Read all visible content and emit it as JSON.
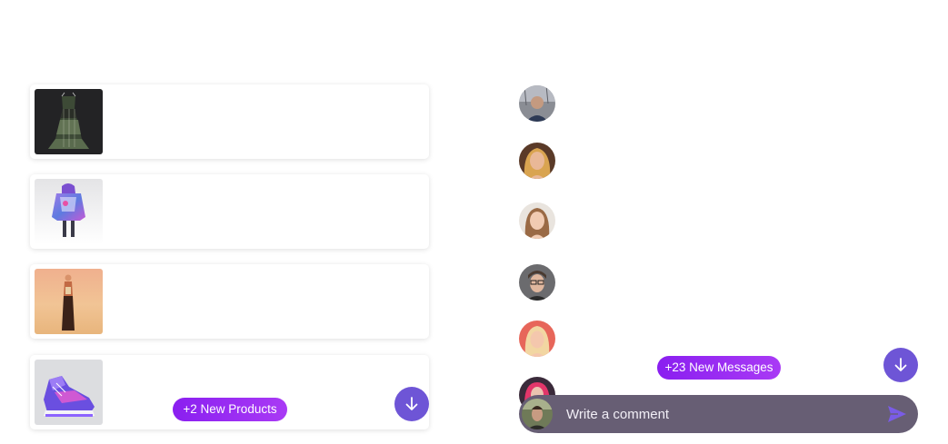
{
  "products": {
    "items": [
      {
        "name": "dark-jacquard-dress"
      },
      {
        "name": "iridescent-puffer-jacket"
      },
      {
        "name": "desert-long-coat-look"
      },
      {
        "name": "purple-high-top-sneaker"
      }
    ],
    "new_products_label": "+2 New Products",
    "scroll_down_icon": "arrow-down-icon"
  },
  "chat": {
    "avatars": [
      {
        "name": "user-avatar-1"
      },
      {
        "name": "user-avatar-2"
      },
      {
        "name": "user-avatar-3"
      },
      {
        "name": "user-avatar-4"
      },
      {
        "name": "user-avatar-5"
      },
      {
        "name": "user-avatar-6"
      }
    ],
    "new_messages_label": "+23 New Messages",
    "scroll_down_icon": "arrow-down-icon",
    "comment": {
      "placeholder": "Write a comment",
      "value": "",
      "send_icon": "send-icon"
    }
  },
  "colors": {
    "accent_purple": "#6e55d6",
    "pill_gradient_start": "#8a1ff0",
    "pill_gradient_end": "#a93af5",
    "comment_bar": "#675e74"
  }
}
